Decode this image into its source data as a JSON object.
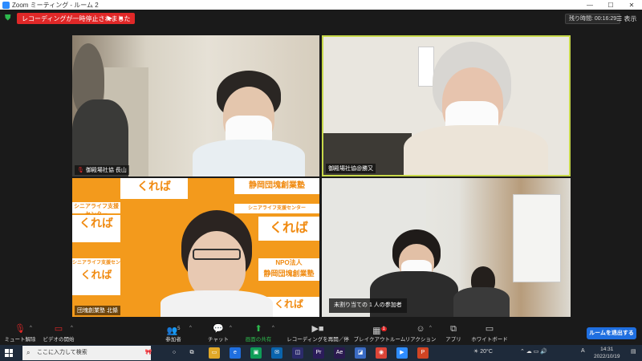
{
  "window": {
    "title": "Zoom ミーティング - ルーム 2"
  },
  "topbar": {
    "recording_status": "レコーディングが一時停止されました",
    "timer_label": "残り時間: 00:16:29",
    "view_label": "表示"
  },
  "participants": [
    {
      "name": "御殿場社協 長山",
      "muted": true
    },
    {
      "name": "御殿場社協@勝又",
      "muted": false
    },
    {
      "name": "団塊創業塾 北條",
      "muted": true
    },
    {
      "name": "",
      "muted": false
    }
  ],
  "banner": {
    "brand": "くれば",
    "org": "静岡団塊創業塾",
    "npo": "NPO法人",
    "tagline": "シニアライフ支援センター"
  },
  "unassigned_notice": "未割り当ての 1 人の参加者",
  "toolbar": {
    "unmute": "ミュート解除",
    "start_video": "ビデオの開始",
    "participants": "参加者",
    "participants_count": "5",
    "chat": "チャット",
    "share": "画面の共有",
    "record": "レコーディングを再開／停止",
    "breakout": "ブレイクアウトルーム",
    "breakout_badge": "1",
    "reactions": "リアクション",
    "apps": "アプリ",
    "whiteboard": "ホワイトボード",
    "leave_room": "ルームを退出する"
  },
  "taskbar": {
    "search_placeholder": "ここに入力して検索",
    "weather": "20°C",
    "ime": "A",
    "time": "14:31",
    "date": "2022/10/19"
  },
  "colors": {
    "accent": "#2d8cff",
    "record_red": "#e02828",
    "active_speaker": "#c8d94a",
    "banner_orange": "#f39a1c"
  }
}
